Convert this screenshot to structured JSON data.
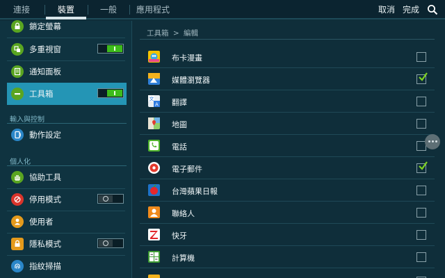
{
  "topbar": {
    "tabs": [
      {
        "label": "連接"
      },
      {
        "label": "裝置"
      },
      {
        "label": "一般"
      },
      {
        "label": "應用程式"
      }
    ],
    "cancel_label": "取消",
    "done_label": "完成",
    "search_icon": "search-icon"
  },
  "sidebar": {
    "items": [
      {
        "label": "鎖定螢幕",
        "icon": "lock-screen-icon"
      },
      {
        "label": "多重視窗",
        "icon": "multi-window-icon",
        "toggle": "on"
      },
      {
        "label": "通知面板",
        "icon": "notification-panel-icon"
      },
      {
        "label": "工具箱",
        "icon": "toolbox-icon",
        "toggle": "on"
      }
    ],
    "section_input": "輸入與控制",
    "items_input": [
      {
        "label": "動作設定",
        "icon": "motion-icon"
      }
    ],
    "section_personal": "個人化",
    "items_personal": [
      {
        "label": "協助工具",
        "icon": "accessibility-icon"
      },
      {
        "label": "停用模式",
        "icon": "blocking-mode-icon",
        "toggle": "off"
      },
      {
        "label": "使用者",
        "icon": "users-icon"
      },
      {
        "label": "隱私模式",
        "icon": "private-mode-icon",
        "toggle": "off"
      },
      {
        "label": "指紋掃描",
        "icon": "fingerprint-icon"
      }
    ]
  },
  "main": {
    "breadcrumb": {
      "parent": "工具箱",
      "separator": ">",
      "current": "編輯"
    },
    "apps": [
      {
        "label": "布卡漫畫",
        "icon": "comic-app-icon",
        "checked": false
      },
      {
        "label": "媒體瀏覽器",
        "icon": "media-browser-icon",
        "checked": true
      },
      {
        "label": "翻譯",
        "icon": "translate-icon",
        "checked": false
      },
      {
        "label": "地圖",
        "icon": "maps-icon",
        "checked": false
      },
      {
        "label": "電話",
        "icon": "phone-icon",
        "checked": false
      },
      {
        "label": "電子郵件",
        "icon": "email-icon",
        "checked": true
      },
      {
        "label": "台灣蘋果日報",
        "icon": "apple-daily-icon",
        "checked": false
      },
      {
        "label": "聯絡人",
        "icon": "contacts-icon",
        "checked": false
      },
      {
        "label": "快牙",
        "icon": "zapya-icon",
        "checked": false
      },
      {
        "label": "計算機",
        "icon": "calculator-icon",
        "checked": false
      }
    ]
  },
  "colors": {
    "accent": "#2495b5",
    "toggle_on": "#3dbb1b",
    "checkmark": "#7ed321",
    "background": "#0f2e3a"
  }
}
